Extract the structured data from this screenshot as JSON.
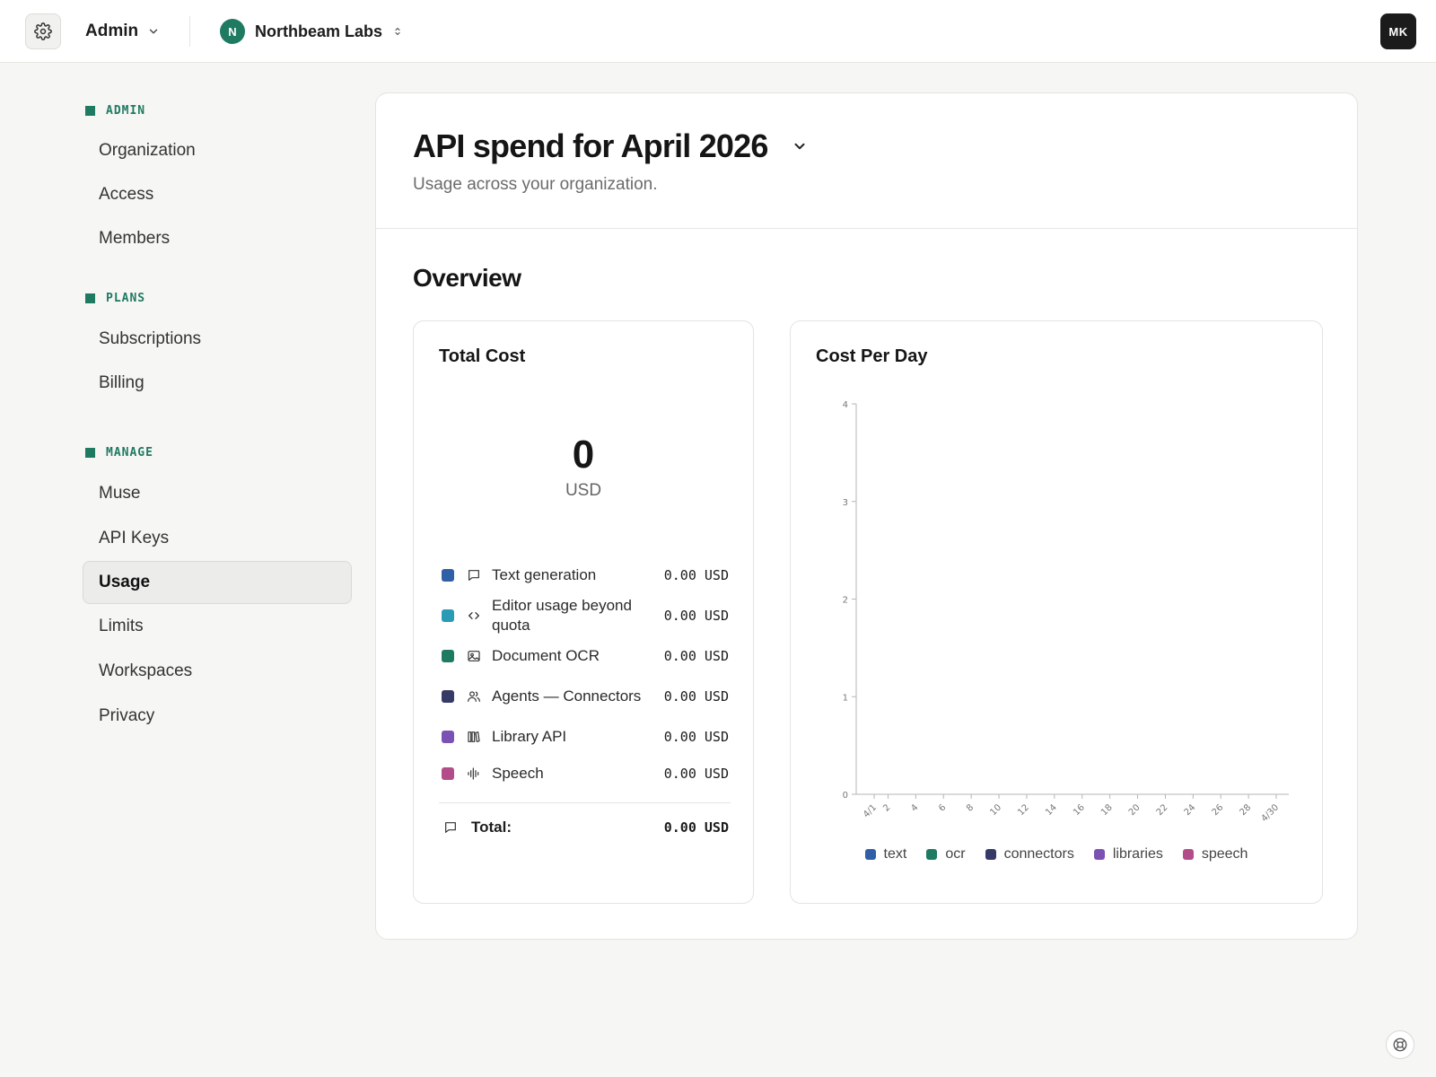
{
  "topbar": {
    "settings_icon": "gear-icon",
    "admin_label": "Admin",
    "org_initial": "N",
    "org_name": "Northbeam Labs",
    "user_initials": "MK"
  },
  "sidebar": {
    "sections": [
      {
        "title": "ADMIN",
        "items": [
          "Organization",
          "Access",
          "Members"
        ]
      },
      {
        "title": "PLANS",
        "items": [
          "Subscriptions",
          "Billing"
        ]
      },
      {
        "title": "MANAGE",
        "items": [
          "Muse",
          "API Keys",
          "Usage",
          "Limits",
          "Workspaces",
          "Privacy"
        ]
      }
    ],
    "active_item": "Usage"
  },
  "main": {
    "title": "API spend for April 2026",
    "subtitle": "Usage across your organization.",
    "overview_title": "Overview",
    "total_cost": {
      "title": "Total Cost",
      "amount": "0",
      "currency": "USD",
      "rows": [
        {
          "label": "Text generation",
          "value": "0.00 USD",
          "color": "#2f5fa7",
          "icon": "chat-bubble-icon"
        },
        {
          "label": "Editor usage beyond quota",
          "value": "0.00 USD",
          "color": "#2a9bb5",
          "icon": "code-icon"
        },
        {
          "label": "Document OCR",
          "value": "0.00 USD",
          "color": "#1f7a62",
          "icon": "image-icon"
        },
        {
          "label": "Agents — Connectors",
          "value": "0.00 USD",
          "color": "#363a66",
          "icon": "users-icon"
        },
        {
          "label": "Library API",
          "value": "0.00 USD",
          "color": "#7b52b3",
          "icon": "library-icon"
        },
        {
          "label": "Speech",
          "value": "0.00 USD",
          "color": "#b24d8a",
          "icon": "waveform-icon"
        }
      ],
      "total_label": "Total:",
      "total_value": "0.00 USD"
    },
    "cost_per_day": {
      "title": "Cost Per Day"
    }
  },
  "chart_data": {
    "type": "bar",
    "title": "Cost Per Day",
    "xlabel": "",
    "ylabel": "",
    "ylim": [
      0,
      4
    ],
    "yticks": [
      0,
      1,
      2,
      3,
      4
    ],
    "xtick_labels": [
      "4/1",
      "2",
      "4",
      "6",
      "8",
      "10",
      "12",
      "14",
      "16",
      "18",
      "20",
      "22",
      "24",
      "26",
      "28",
      "4/30"
    ],
    "x_days": [
      1,
      2,
      4,
      6,
      8,
      10,
      12,
      14,
      16,
      18,
      20,
      22,
      24,
      26,
      28,
      30
    ],
    "categories_range": [
      1,
      30
    ],
    "series": [
      {
        "name": "text",
        "color": "#2f5fa7",
        "values": []
      },
      {
        "name": "ocr",
        "color": "#1f7a62",
        "values": []
      },
      {
        "name": "connectors",
        "color": "#363a66",
        "values": []
      },
      {
        "name": "libraries",
        "color": "#7b52b3",
        "values": []
      },
      {
        "name": "speech",
        "color": "#b24d8a",
        "values": []
      }
    ],
    "legend": "bottom",
    "grid": false
  }
}
